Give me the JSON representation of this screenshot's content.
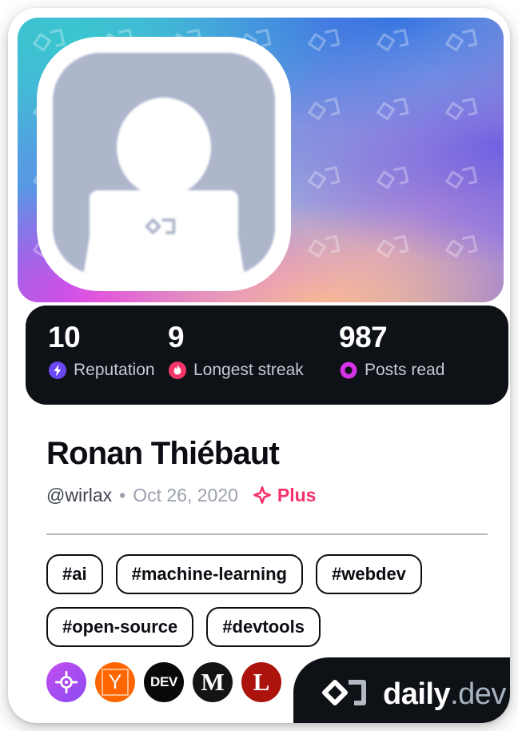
{
  "card": {
    "accent_pink": "#f5336a",
    "dark_panel": "#0e1217"
  },
  "cover": {
    "alt": "profile cover gradient with daily.dev logo pattern",
    "avatar_alt": "default user avatar placeholder"
  },
  "stats": [
    {
      "value": "10",
      "label": "Reputation",
      "icon": "reputation-bolt-icon",
      "color": "#6c47f5"
    },
    {
      "value": "9",
      "label": "Longest streak",
      "icon": "streak-flame-icon",
      "color": "#f5366a"
    },
    {
      "value": "987",
      "label": "Posts read",
      "icon": "posts-read-eye-icon",
      "color": "#d633e8"
    }
  ],
  "profile": {
    "name": "Ronan Thiébaut",
    "handle": "@wirlax",
    "separator": "•",
    "joined": "Oct 26, 2020",
    "plus_label": "Plus",
    "plus_icon": "plus-sparkle-icon"
  },
  "tags": [
    "#ai",
    "#machine-learning",
    "#webdev",
    "#open-source",
    "#devtools"
  ],
  "sources": [
    {
      "name": "daily-dev-source-icon",
      "title": "daily.dev"
    },
    {
      "name": "ycombinator-source-icon",
      "title": "Y",
      "glyph": "Y"
    },
    {
      "name": "devto-source-icon",
      "title": "DEV",
      "glyph": "DEV"
    },
    {
      "name": "medium-source-icon",
      "title": "Medium",
      "glyph": "M"
    },
    {
      "name": "lobsters-source-icon",
      "title": "Lobsters",
      "glyph": "L"
    }
  ],
  "brand": {
    "name": "daily",
    "suffix": ".dev",
    "logo_icon": "daily-dev-logo-icon"
  }
}
